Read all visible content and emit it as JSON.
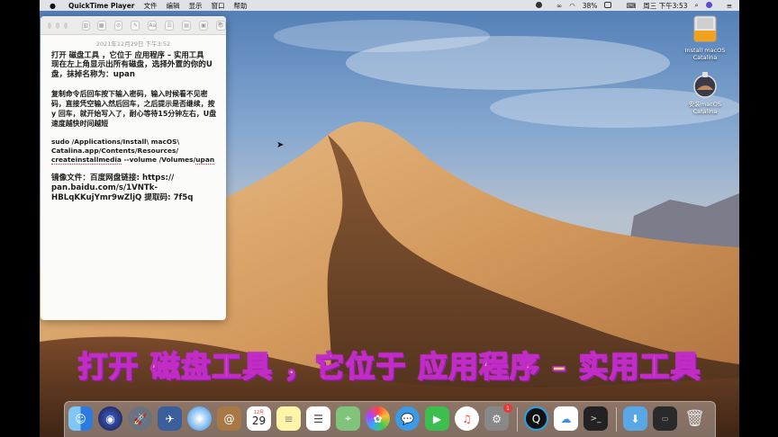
{
  "menubar": {
    "app_name": "QuickTime Player",
    "items": [
      "文件",
      "编辑",
      "显示",
      "窗口",
      "帮助"
    ],
    "battery": "38%",
    "clock": "周三 下午3:53"
  },
  "notes": {
    "date": "2021年12月29日 下午3:52",
    "lines_a": [
      "打开 磁盘工具 ，它位于 应用程序 – 实用工具",
      "现在左上角显示出所有磁盘，选择外置的你的U盘，抹掉名称为：upan"
    ],
    "lines_b": [
      "复制命令后回车按下输入密码，输入时候看不见密码，直接凭空输入然后回车，之后提示是否继续，按 y 回车，就开始写入了，耐心等待15分钟左右，U盘速度越快时间越短"
    ],
    "cmd_1": "sudo /Applications/Install\\ macOS\\ Catalina.app/Contents/Resources/",
    "cmd_2a": "createinstallmedia",
    "cmd_2b": " --volume /Volumes/",
    "cmd_2c": "upan",
    "mirror_1": "镜像文件：百度网盘链接: https://",
    "mirror_2": "pan.baidu.com/s/1VNTk-",
    "mirror_3": "HBLqKKujYmr9wZljQ 提取码: 7f5q"
  },
  "desktop": {
    "icon1_label_1": "Install macOS",
    "icon1_label_2": "Catalina",
    "icon2_label_1": "安装macOS",
    "icon2_label_2": "Catalina"
  },
  "subtitle": "打开 磁盘工具 ，它位于 应用程序 – 实用工具",
  "dock": {
    "calendar_month": "12月",
    "calendar_day": "29",
    "appstore_badge": "1"
  },
  "colors": {
    "subtitle_fill": "#ffe06a",
    "subtitle_stroke": "#c02cc4"
  }
}
